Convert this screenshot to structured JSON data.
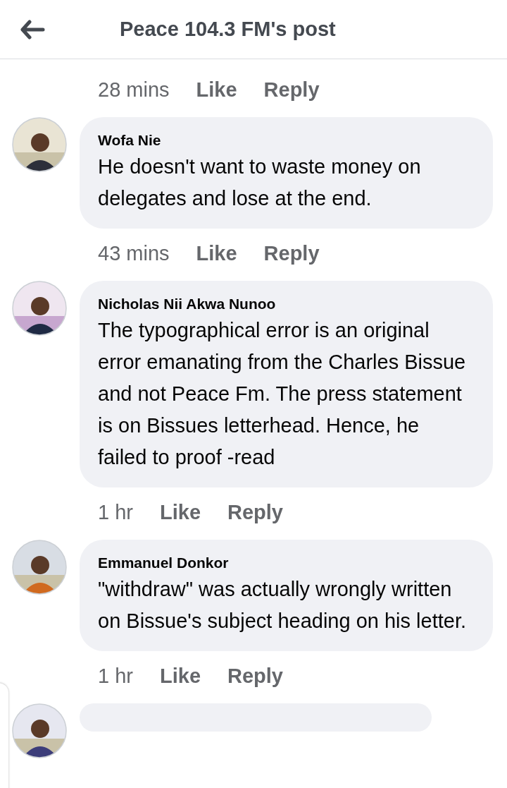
{
  "header": {
    "title": "Peace 104.3 FM's post"
  },
  "top_meta": {
    "time": "28 mins",
    "like": "Like",
    "reply": "Reply"
  },
  "comments": [
    {
      "author": "Wofa Nie",
      "text": "He doesn't want to waste money on delegates and lose at the end.",
      "time": "43 mins",
      "like": "Like",
      "reply": "Reply"
    },
    {
      "author": "Nicholas Nii Akwa Nunoo",
      "text": "The typographical error is an original error emanating from the Charles Bissue and not Peace Fm. The press statement is on Bissues letterhead. Hence, he failed to proof -read",
      "time": "1 hr",
      "like": "Like",
      "reply": "Reply"
    },
    {
      "author": "Emmanuel Donkor",
      "text": "\"withdraw\" was actually wrongly written on Bissue's subject heading on his letter.",
      "time": "1 hr",
      "like": "Like",
      "reply": "Reply"
    }
  ]
}
